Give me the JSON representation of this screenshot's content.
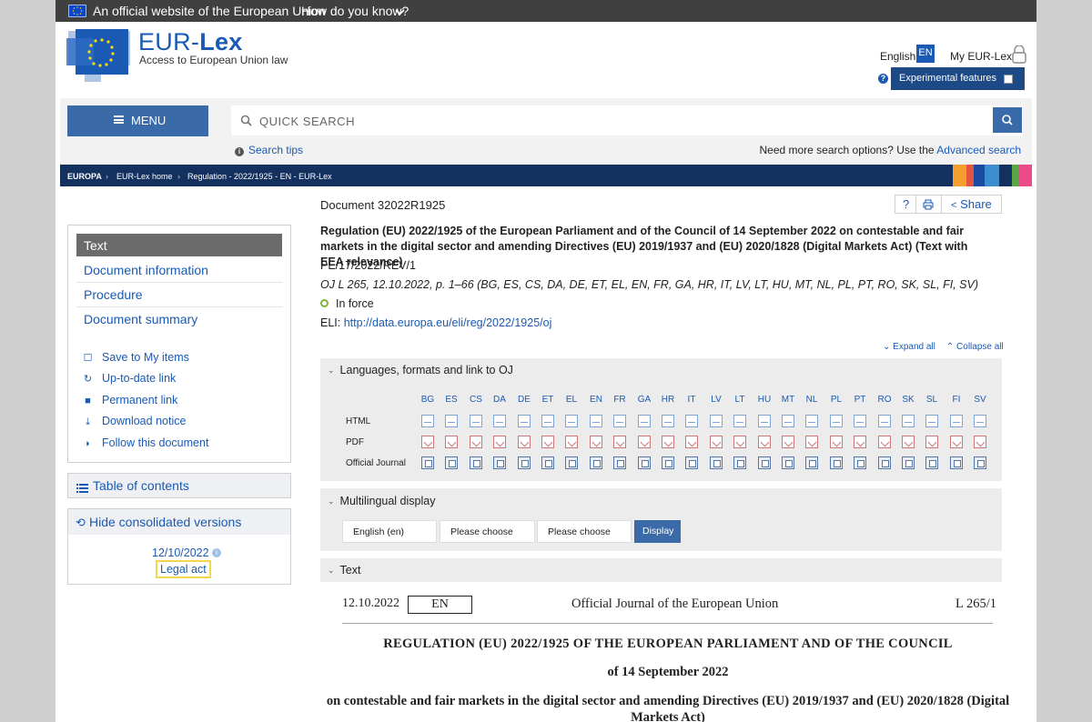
{
  "topbar": {
    "official_text": "An official website of the European Union",
    "how_text": "How do you know?"
  },
  "header": {
    "brand_prefix": "EUR-",
    "brand_bold": "Lex",
    "tagline": "Access to European Union law",
    "language_label": "English",
    "language_code": "EN",
    "my_eurlex": "My EUR-Lex",
    "experimental": "Experimental features"
  },
  "search": {
    "menu_label": "MENU",
    "placeholder": "QUICK SEARCH",
    "search_tips": "Search tips",
    "need_more": "Need more search options? Use the ",
    "advanced": "Advanced search"
  },
  "breadcrumb": {
    "europa": "EUROPA",
    "home": "EUR-Lex home",
    "current": "Regulation - 2022/1925 - EN - EUR-Lex"
  },
  "sidebar": {
    "active_tab": "Text",
    "nav": [
      "Document information",
      "Procedure",
      "Document summary"
    ],
    "actions": [
      {
        "label": "Save to My items",
        "icon": "bookmark-outline-icon"
      },
      {
        "label": "Up-to-date link",
        "icon": "refresh-icon"
      },
      {
        "label": "Permanent link",
        "icon": "bookmark-icon"
      },
      {
        "label": "Download notice",
        "icon": "download-icon"
      },
      {
        "label": "Follow this document",
        "icon": "rss-icon"
      }
    ],
    "toc": "Table of contents",
    "hide_consolidated": "Hide consolidated versions",
    "consolidated_date": "12/10/2022",
    "legal_act": "Legal act"
  },
  "document": {
    "number": "Document 32022R1925",
    "share": "Share",
    "title": "Regulation (EU) 2022/1925 of the European Parliament and of the Council of 14 September 2022 on contestable and fair markets in the digital sector and amending Directives (EU) 2019/1937 and (EU) 2020/1828 (Digital Markets Act) (Text with EEA relevance)",
    "pe_ref": "PE/17/2022/REV/1",
    "oj_ref": "OJ L 265, 12.10.2022, p. 1–66 (BG, ES, CS, DA, DE, ET, EL, EN, FR, GA, HR, IT, LV, LT, HU, MT, NL, PL, PT, RO, SK, SL, FI, SV)",
    "status": "In force",
    "eli_label": "ELI: ",
    "eli_url": "http://data.europa.eu/eli/reg/2022/1925/oj",
    "expand_all": "Expand all",
    "collapse_all": "Collapse all"
  },
  "languages_section": {
    "title": "Languages, formats and link to OJ",
    "languages": [
      "BG",
      "ES",
      "CS",
      "DA",
      "DE",
      "ET",
      "EL",
      "EN",
      "FR",
      "GA",
      "HR",
      "IT",
      "LV",
      "LT",
      "HU",
      "MT",
      "NL",
      "PL",
      "PT",
      "RO",
      "SK",
      "SL",
      "FI",
      "SV"
    ],
    "rows": [
      "HTML",
      "PDF",
      "Official Journal"
    ]
  },
  "multilingual": {
    "title": "Multilingual display",
    "select1": "English (en)",
    "select2": "Please choose",
    "select3": "Please choose",
    "display": "Display"
  },
  "text_section": {
    "title": "Text"
  },
  "oj": {
    "date": "12.10.2022",
    "lang": "EN",
    "journal": "Official Journal of the European Union",
    "ref": "L 265/1",
    "heading": "REGULATION (EU) 2022/1925 OF THE EUROPEAN PARLIAMENT AND OF THE COUNCIL",
    "date_line": "of 14 September 2022",
    "subtitle": "on contestable and fair markets in the digital sector and amending Directives (EU) 2019/1937 and (EU) 2020/1828 (Digital Markets Act)"
  },
  "colors": {
    "brand": "#1a5ab4",
    "navy": "#14305e",
    "button": "#3a6aa8",
    "stripes": [
      "#f49e2e",
      "#e4553f",
      "#1b4aa3",
      "#3b8ed0",
      "#14305e",
      "#57a845",
      "#ea4c89"
    ]
  }
}
